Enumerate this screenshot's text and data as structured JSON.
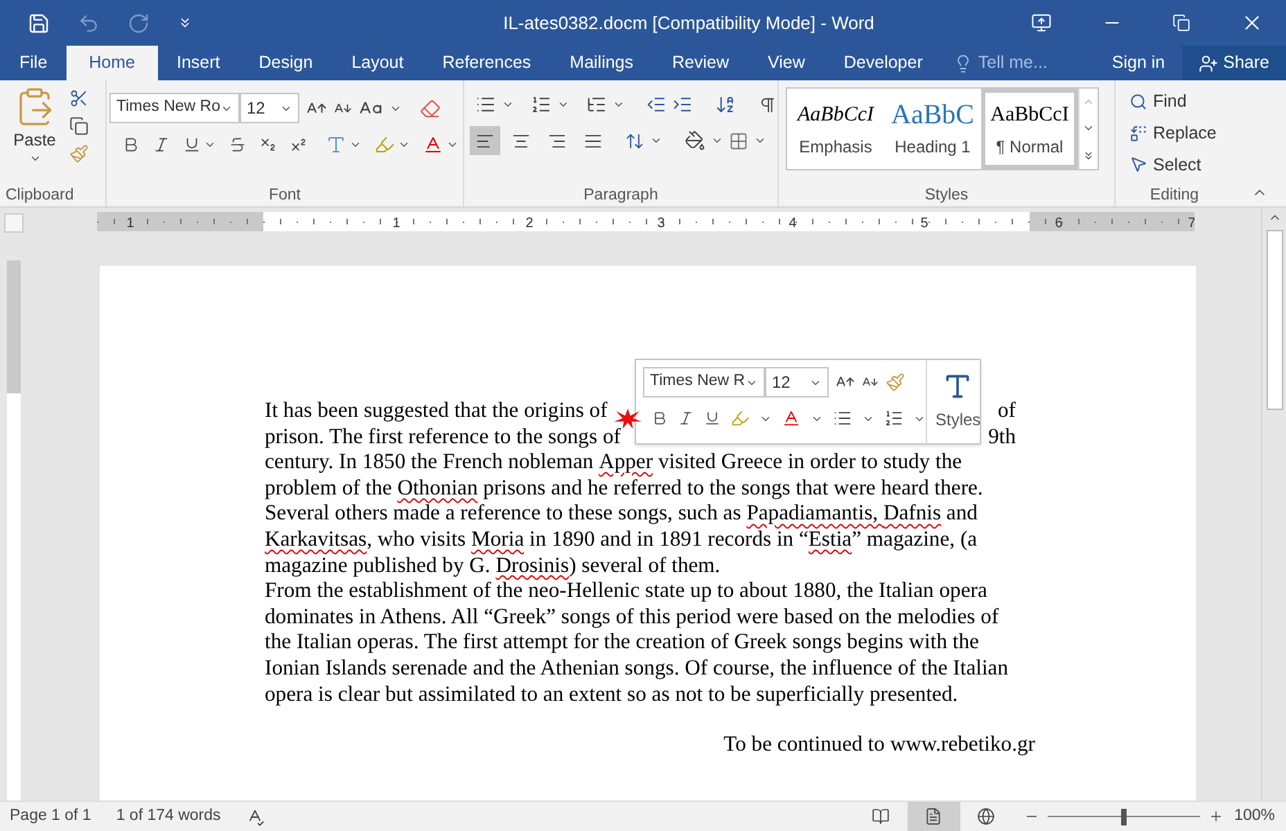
{
  "window": {
    "title": "IL-ates0382.docm [Compatibility Mode] - Word"
  },
  "quick_access": [
    {
      "kind": "save",
      "disabled": false
    },
    {
      "kind": "undo",
      "disabled": true
    },
    {
      "kind": "redo",
      "disabled": true
    },
    {
      "kind": "customize",
      "disabled": false
    }
  ],
  "tabs": [
    {
      "label": "File",
      "selected": false
    },
    {
      "label": "Home",
      "selected": true
    },
    {
      "label": "Insert",
      "selected": false
    },
    {
      "label": "Design",
      "selected": false
    },
    {
      "label": "Layout",
      "selected": false
    },
    {
      "label": "References",
      "selected": false
    },
    {
      "label": "Mailings",
      "selected": false
    },
    {
      "label": "Review",
      "selected": false
    },
    {
      "label": "View",
      "selected": false
    },
    {
      "label": "Developer",
      "selected": false
    }
  ],
  "tell_me": {
    "placeholder": "Tell me..."
  },
  "sign_in": "Sign in",
  "share": "Share",
  "ribbon": {
    "clipboard": {
      "paste": "Paste",
      "label": "Clipboard"
    },
    "font": {
      "name": "Times New Ro",
      "size": "12",
      "label": "Font"
    },
    "paragraph": {
      "label": "Paragraph",
      "align": [
        {
          "kind": "left",
          "selected": true
        },
        {
          "kind": "center",
          "selected": false
        },
        {
          "kind": "right",
          "selected": false
        },
        {
          "kind": "justify",
          "selected": false
        }
      ]
    },
    "styles": {
      "label": "Styles",
      "items": [
        {
          "kind": "emphasis",
          "preview": "AaBbCcI",
          "name": "Emphasis",
          "selected": false
        },
        {
          "kind": "heading",
          "preview": "AaBbC",
          "name": "Heading 1",
          "selected": false
        },
        {
          "kind": "normal",
          "preview": "AaBbCcI",
          "name": "¶ Normal",
          "selected": true
        }
      ]
    },
    "editing": {
      "label": "Editing",
      "items": [
        {
          "kind": "find",
          "label": "Find"
        },
        {
          "kind": "replace",
          "label": "Replace"
        },
        {
          "kind": "select",
          "label": "Select"
        }
      ]
    }
  },
  "ruler": {
    "labels": [
      "1",
      "1",
      "2",
      "3",
      "4",
      "5",
      "6",
      "7"
    ]
  },
  "mini_toolbar": {
    "font": "Times New R",
    "size": "12",
    "styles": "Styles"
  },
  "document": {
    "paragraphs": [
      {
        "lines": [
          {
            "left": [
              {
                "text": "It has been suggested that the origins of",
                "misspelled": false
              }
            ],
            "right": [
              {
                "text": "of",
                "misspelled": false
              }
            ]
          },
          {
            "left": [
              {
                "text": "prison. The first reference to the songs of",
                "misspelled": false
              }
            ],
            "right": [
              {
                "text": "9th",
                "misspelled": false
              }
            ]
          },
          {
            "left": [
              {
                "text": "century. In 1850 the French nobleman ",
                "misspelled": false
              },
              {
                "text": "Apper",
                "misspelled": true
              },
              {
                "text": " visited Greece in order to study the",
                "misspelled": false
              }
            ]
          },
          {
            "left": [
              {
                "text": "problem of the ",
                "misspelled": false
              },
              {
                "text": "Othonian",
                "misspelled": true
              },
              {
                "text": " prisons and he referred to the songs that were heard there.",
                "misspelled": false
              }
            ]
          },
          {
            "left": [
              {
                "text": "Several others made a reference to these songs, such as ",
                "misspelled": false
              },
              {
                "text": "Papadiamantis, ",
                "misspelled": true
              },
              {
                "text": "Dafnis",
                "misspelled": true
              },
              {
                "text": " and",
                "misspelled": false
              }
            ]
          },
          {
            "left": [
              {
                "text": "Karkavitsas",
                "misspelled": true
              },
              {
                "text": ", who visits ",
                "misspelled": false
              },
              {
                "text": "Moria",
                "misspelled": true
              },
              {
                "text": " in 1890 and in 1891 records in “",
                "misspelled": false
              },
              {
                "text": "Estia",
                "misspelled": true
              },
              {
                "text": "” magazine, (a",
                "misspelled": false
              }
            ]
          },
          {
            "left": [
              {
                "text": "magazine published by G. ",
                "misspelled": false
              },
              {
                "text": "Drosinis",
                "misspelled": true
              },
              {
                "text": ") several of them.",
                "misspelled": false
              }
            ]
          }
        ]
      },
      {
        "lines": [
          {
            "left": [
              {
                "text": "From the establishment of the neo-Hellenic state up to about 1880, the Italian opera",
                "misspelled": false
              }
            ]
          },
          {
            "left": [
              {
                "text": "dominates in Athens. All “Greek” songs of this period were based on the melodies of",
                "misspelled": false
              }
            ]
          },
          {
            "left": [
              {
                "text": "the Italian operas. The first attempt for the creation of Greek songs begins with the",
                "misspelled": false
              }
            ]
          },
          {
            "left": [
              {
                "text": "Ionian Islands serenade and the Athenian songs. Of course, the influence of the Italian",
                "misspelled": false
              }
            ]
          },
          {
            "left": [
              {
                "text": "opera is clear but assimilated to an extent so as not to be superficially presented.",
                "misspelled": false
              }
            ]
          }
        ]
      }
    ],
    "closing": "To be continued to www.rebetiko.gr"
  },
  "status_bar": {
    "page": "Page 1 of 1",
    "words": "1 of 174 words",
    "views": [
      {
        "kind": "read",
        "selected": false
      },
      {
        "kind": "print",
        "selected": true
      },
      {
        "kind": "web",
        "selected": false
      }
    ],
    "zoom": {
      "level": 0.5,
      "reading": "100%"
    }
  }
}
